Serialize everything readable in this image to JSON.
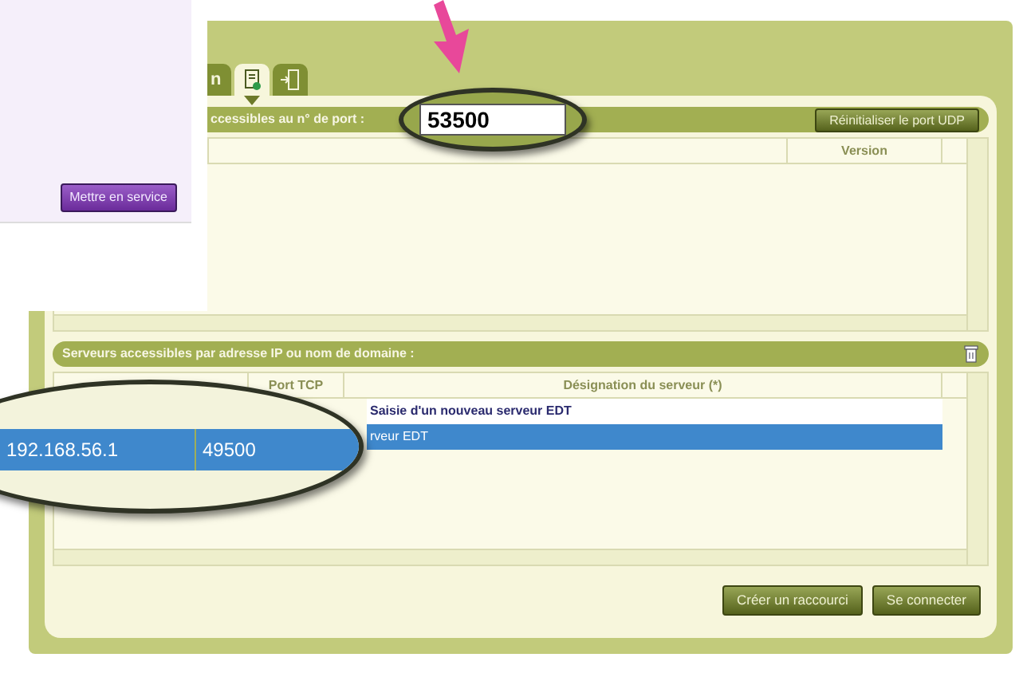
{
  "side_panel": {
    "button": "Mettre en service"
  },
  "tabs": [
    {
      "kind": "text",
      "label": "n",
      "selected": false
    },
    {
      "kind": "add",
      "selected": true
    },
    {
      "kind": "exit",
      "selected": false
    }
  ],
  "udp_section": {
    "title": "ccessibles au n° de port :",
    "port": {
      "value": "53500"
    },
    "button": "Réinitialiser le port UDP",
    "columns": [
      "",
      "",
      "Version"
    ]
  },
  "ip_section": {
    "title": "Serveurs accessibles par adresse IP ou nom de domaine :",
    "columns": [
      "",
      "Port TCP",
      "Désignation du serveur (*)"
    ],
    "rows": [
      {
        "address": "",
        "port": "",
        "designation": "Saisie d'un nouveau serveur EDT",
        "selected": false,
        "kind": "new"
      },
      {
        "address": "192.168.56.1",
        "port": "49500",
        "designation": "rveur EDT",
        "selected": true,
        "kind": "server"
      }
    ]
  },
  "buttons": [
    "Créer un raccourci",
    "Se connecter"
  ]
}
